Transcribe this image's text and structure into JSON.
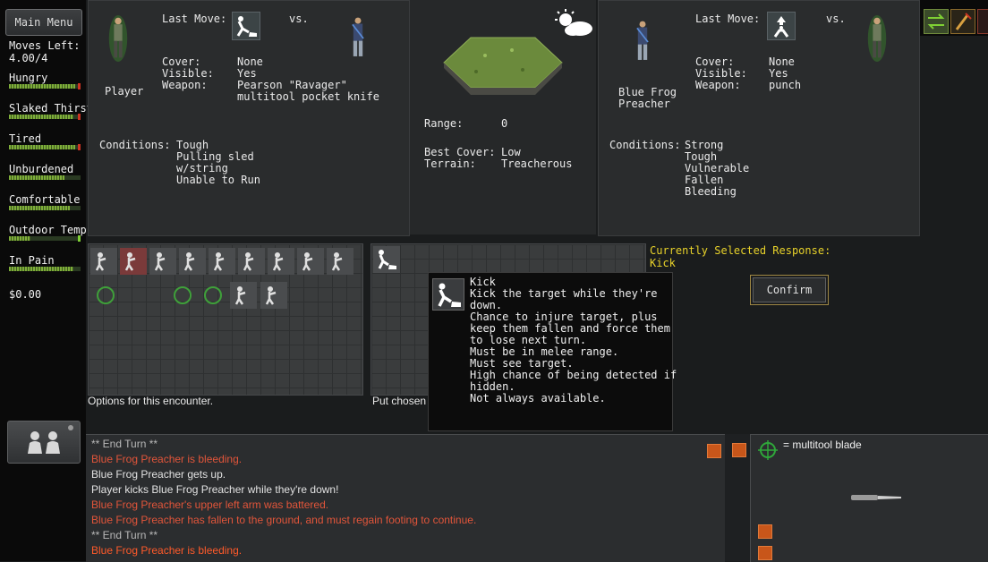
{
  "main_menu_label": "Main Menu",
  "sidebar": {
    "stats": [
      {
        "label": "Moves Left:",
        "sub": "4.00/4",
        "level": null
      },
      {
        "label": "Hungry",
        "level": 0.92,
        "tick": "#cc3322"
      },
      {
        "label": "Slaked Thirst",
        "level": 0.9,
        "tick": "#cc3322"
      },
      {
        "label": "Tired",
        "level": 0.92,
        "tick": "#cc3322"
      },
      {
        "label": "Unburdened",
        "level": 0.78,
        "tick": null
      },
      {
        "label": "Comfortable",
        "level": 0.85,
        "tick": null
      },
      {
        "label": "Outdoor Temp",
        "level": 0.3,
        "tick": "#7fd034"
      },
      {
        "label": "In Pain",
        "level": 0.9,
        "tick": null
      }
    ],
    "money": "$0.00"
  },
  "left_combatant": {
    "name": "Player",
    "last_move_label": "Last Move:",
    "vs_label": "vs.",
    "cover_label": "Cover:",
    "cover": "None",
    "visible_label": "Visible:",
    "visible": "Yes",
    "weapon_label": "Weapon:",
    "weapon_lines": [
      "Pearson \"Ravager\"",
      "multitool pocket knife"
    ],
    "conditions_label": "Conditions:",
    "conditions": [
      "Tough",
      "Pulling sled",
      "w/string",
      "Unable to Run"
    ]
  },
  "terrain": {
    "range_label": "Range:",
    "range": "0",
    "best_cover_label": "Best Cover:",
    "best_cover": "Low",
    "terrain_label": "Terrain:",
    "terrain": "Treacherous",
    "weather_icon": "partly-cloudy-icon"
  },
  "right_combatant": {
    "name_lines": [
      "Blue Frog",
      "Preacher"
    ],
    "last_move_label": "Last Move:",
    "vs_label": "vs.",
    "cover_label": "Cover:",
    "cover": "None",
    "visible_label": "Visible:",
    "visible": "Yes",
    "weapon_label": "Weapon:",
    "weapon": "punch",
    "conditions_label": "Conditions:",
    "conditions": [
      "Strong",
      "Tough",
      "Vulnerable",
      "Fallen",
      "Bleeding"
    ]
  },
  "options_caption": "Options for this encounter.",
  "chosen_caption": "Put chosen options",
  "response": {
    "label": "Currently Selected Response:",
    "value": "Kick"
  },
  "confirm_label": "Confirm",
  "tooltip": {
    "lines": [
      "Kick",
      "Kick the target while they're",
      "down.",
      "Chance to injure target, plus",
      "keep them fallen and force them",
      "to lose next turn.",
      "Must be in melee range.",
      "Must see target.",
      "High chance of being detected if",
      "hidden.",
      "Not always available."
    ]
  },
  "log": [
    {
      "text": "** End Turn **",
      "color": "#b8b8b8"
    },
    {
      "text": "Blue Frog Preacher is bleeding.",
      "color": "#e2553a"
    },
    {
      "text": "Blue Frog Preacher gets up.",
      "color": "#e2e2e2"
    },
    {
      "text": "Player kicks Blue Frog Preacher while they're down!",
      "color": "#e2e2e2"
    },
    {
      "text": "Blue Frog Preacher's upper left arm was battered.",
      "color": "#e2553a"
    },
    {
      "text": "Blue Frog Preacher has fallen to the ground, and must regain footing to continue.",
      "color": "#e2553a"
    },
    {
      "text": "** End Turn **",
      "color": "#b8b8b8"
    },
    {
      "text": "Blue Frog Preacher is bleeding.",
      "color": "#ff5a2a"
    }
  ],
  "item_panel": {
    "legend": "= multitool blade"
  }
}
